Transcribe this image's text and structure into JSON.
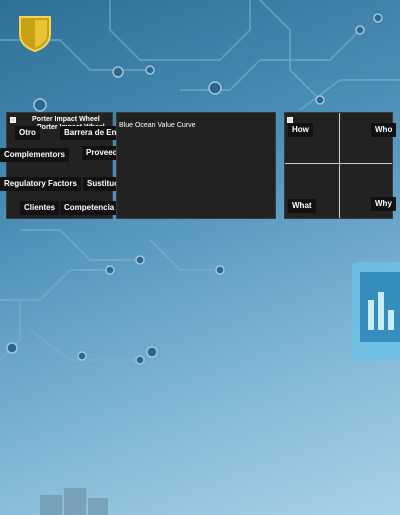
{
  "porter": {
    "title": "Porter Impact Wheel",
    "subtitle": "Porter Impact Wheel",
    "chips": {
      "otro": "Otro",
      "barrera": "Barrera de Entrada",
      "complementors": "Complementors",
      "proveedores": "Proveedores",
      "regulatory": "Regulatory Factors",
      "sustitutos": "Sustituos",
      "clientes": "Clientes",
      "competencia": "Competencia"
    }
  },
  "blue_ocean": {
    "title": "Blue Ocean Value Curve"
  },
  "matrix": {
    "how": "How",
    "who": "Who",
    "what": "What",
    "why": "Why"
  },
  "colors": {
    "panel_bg": "#222222",
    "chip_bg": "#111111",
    "logo": "#d9b21f"
  },
  "icons": [
    "shield-logo-icon",
    "panel-menu-icon"
  ]
}
